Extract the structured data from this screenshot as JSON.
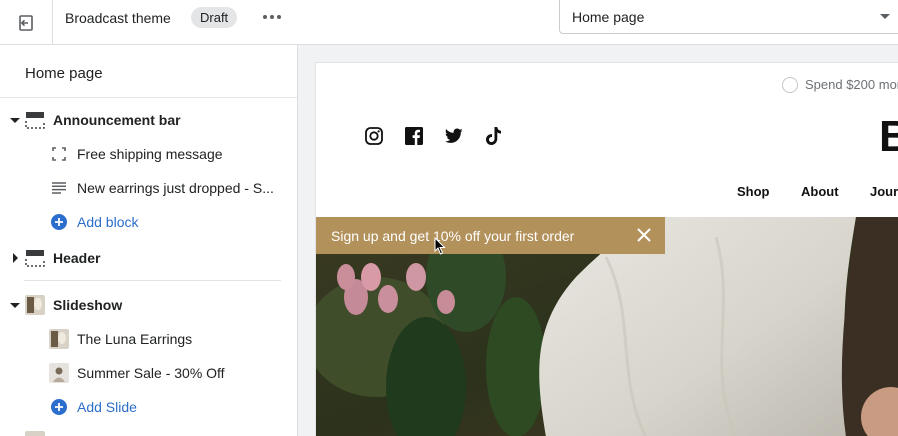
{
  "topbar": {
    "theme_name": "Broadcast theme",
    "status_badge": "Draft",
    "page_select_value": "Home page"
  },
  "sidebar": {
    "title": "Home page",
    "sections": [
      {
        "label": "Announcement bar",
        "expanded": true
      },
      {
        "label": "Header",
        "expanded": false
      },
      {
        "label": "Slideshow",
        "expanded": true
      }
    ],
    "announcement_blocks": [
      "Free shipping message",
      "New earrings just dropped - S..."
    ],
    "announcement_add": "Add block",
    "slideshow_blocks": [
      "The Luna Earrings",
      "Summer Sale - 30% Off"
    ],
    "slideshow_add": "Add Slide"
  },
  "preview": {
    "spend_text": "Spend $200 mor",
    "logo_fragment": "B",
    "nav": [
      "Shop",
      "About",
      "Jour"
    ],
    "promo_text": "Sign up and get 10% off your first order",
    "social_icons": [
      "instagram-icon",
      "facebook-icon",
      "twitter-icon",
      "tiktok-icon"
    ]
  },
  "colors": {
    "promo_bg": "#b2915b",
    "link_blue": "#2c6ecb"
  }
}
